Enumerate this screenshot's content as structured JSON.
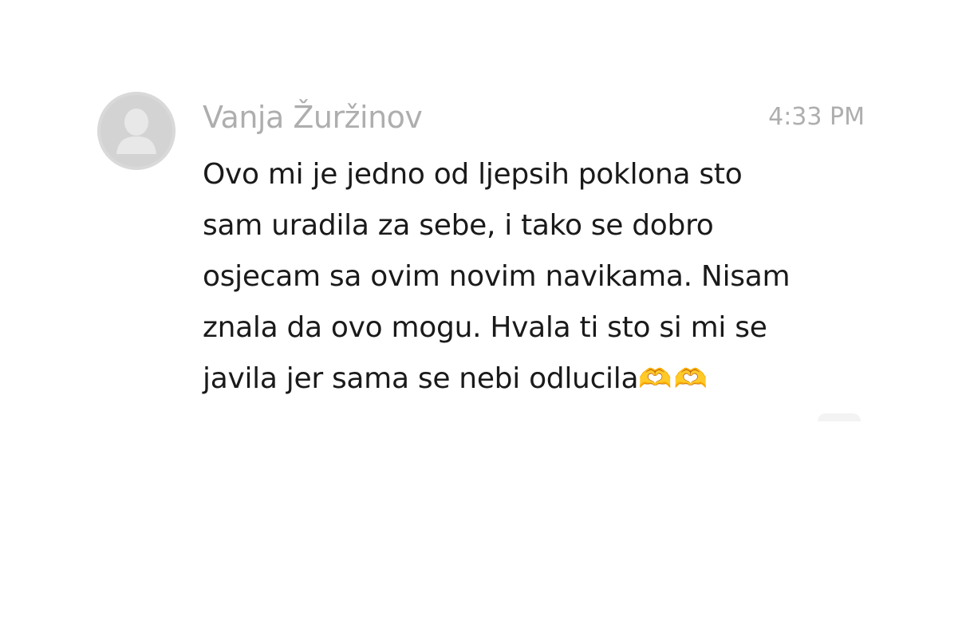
{
  "message": {
    "sender": "Vanja Žuržinov",
    "time": "4:33 PM",
    "lines": [
      "Ovo mi je jedno od ljepsih poklona sto",
      "sam uradila za sebe, i tako se dobro",
      "osjecam sa ovim novim navikama. Nisam",
      "znala da ovo mogu. Hvala ti sto si mi se",
      "javila jer sama se nebi odlucila"
    ],
    "emoji": "🫶🫶",
    "emoji_icon": "heart-hands-icon",
    "avatar_icon": "default-user-avatar-icon"
  },
  "colors": {
    "sender": "#aeaeae",
    "time": "#aeaeae",
    "text": "#1a1a1a",
    "avatar_bg": "#d3d3d3"
  }
}
